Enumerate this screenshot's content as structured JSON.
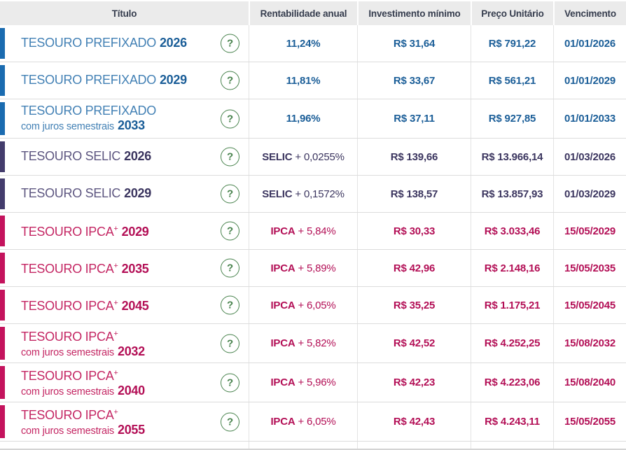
{
  "table": {
    "columns": [
      {
        "label": "Título"
      },
      {
        "label": "Rentabilidade anual"
      },
      {
        "label": "Investimento mínimo"
      },
      {
        "label": "Preço Unitário"
      },
      {
        "label": "Vencimento"
      }
    ],
    "help_icon_glyph": "?",
    "bonds": [
      {
        "type": "prefixado",
        "name": "TESOURO PREFIXADO",
        "sup": "",
        "subtitle": "",
        "year": "2026",
        "rate_bold": "11,24%",
        "rate_rest": "",
        "min_investment": "R$ 31,64",
        "unit_price": "R$ 791,22",
        "maturity": "01/01/2026"
      },
      {
        "type": "prefixado",
        "name": "TESOURO PREFIXADO",
        "sup": "",
        "subtitle": "",
        "year": "2029",
        "rate_bold": "11,81%",
        "rate_rest": "",
        "min_investment": "R$ 33,67",
        "unit_price": "R$ 561,21",
        "maturity": "01/01/2029"
      },
      {
        "type": "prefixado",
        "name": "TESOURO PREFIXADO",
        "sup": "",
        "subtitle": "com juros semestrais",
        "year": "2033",
        "rate_bold": "11,96%",
        "rate_rest": "",
        "min_investment": "R$ 37,11",
        "unit_price": "R$ 927,85",
        "maturity": "01/01/2033"
      },
      {
        "type": "selic",
        "name": "TESOURO SELIC",
        "sup": "",
        "subtitle": "",
        "year": "2026",
        "rate_bold": "SELIC",
        "rate_rest": "+ 0,0255%",
        "min_investment": "R$ 139,66",
        "unit_price": "R$ 13.966,14",
        "maturity": "01/03/2026"
      },
      {
        "type": "selic",
        "name": "TESOURO SELIC",
        "sup": "",
        "subtitle": "",
        "year": "2029",
        "rate_bold": "SELIC",
        "rate_rest": "+ 0,1572%",
        "min_investment": "R$ 138,57",
        "unit_price": "R$ 13.857,93",
        "maturity": "01/03/2029"
      },
      {
        "type": "ipca",
        "name": "TESOURO IPCA",
        "sup": "+",
        "subtitle": "",
        "year": "2029",
        "rate_bold": "IPCA",
        "rate_rest": "+ 5,84%",
        "min_investment": "R$ 30,33",
        "unit_price": "R$ 3.033,46",
        "maturity": "15/05/2029"
      },
      {
        "type": "ipca",
        "name": "TESOURO IPCA",
        "sup": "+",
        "subtitle": "",
        "year": "2035",
        "rate_bold": "IPCA",
        "rate_rest": "+ 5,89%",
        "min_investment": "R$ 42,96",
        "unit_price": "R$ 2.148,16",
        "maturity": "15/05/2035"
      },
      {
        "type": "ipca",
        "name": "TESOURO IPCA",
        "sup": "+",
        "subtitle": "",
        "year": "2045",
        "rate_bold": "IPCA",
        "rate_rest": "+ 6,05%",
        "min_investment": "R$ 35,25",
        "unit_price": "R$ 1.175,21",
        "maturity": "15/05/2045"
      },
      {
        "type": "ipca",
        "name": "TESOURO IPCA",
        "sup": "+",
        "subtitle": "com juros semestrais",
        "year": "2032",
        "rate_bold": "IPCA",
        "rate_rest": "+ 5,82%",
        "min_investment": "R$ 42,52",
        "unit_price": "R$ 4.252,25",
        "maturity": "15/08/2032"
      },
      {
        "type": "ipca",
        "name": "TESOURO IPCA",
        "sup": "+",
        "subtitle": "com juros semestrais",
        "year": "2040",
        "rate_bold": "IPCA",
        "rate_rest": "+ 5,96%",
        "min_investment": "R$ 42,23",
        "unit_price": "R$ 4.223,06",
        "maturity": "15/08/2040"
      },
      {
        "type": "ipca",
        "name": "TESOURO IPCA",
        "sup": "+",
        "subtitle": "com juros semestrais",
        "year": "2055",
        "rate_bold": "IPCA",
        "rate_rest": "+ 6,05%",
        "min_investment": "R$ 42,43",
        "unit_price": "R$ 4.243,11",
        "maturity": "15/05/2055"
      }
    ]
  },
  "colors": {
    "header_bg": "#ebebeb",
    "header_text": "#363d4e",
    "help_green": "#47824c",
    "types": {
      "prefixado": {
        "bar": "#1a6bb0",
        "name": "#4381b5",
        "strong": "#1b5e98"
      },
      "selic": {
        "bar": "#433c6c",
        "name": "#5d5680",
        "strong": "#3b355f"
      },
      "ipca": {
        "bar": "#c4135d",
        "name": "#c42663",
        "strong": "#b30f56"
      }
    }
  }
}
